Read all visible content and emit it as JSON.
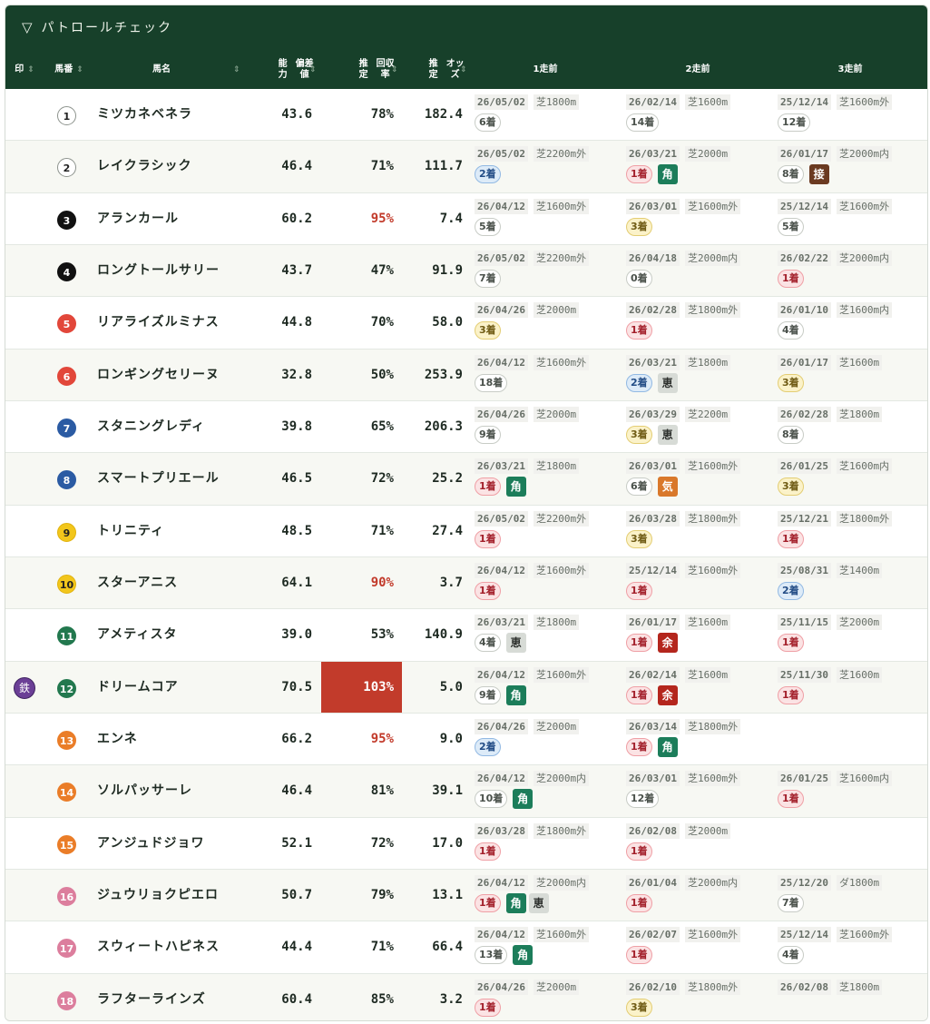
{
  "title": "パトロールチェック",
  "toggle_icon": "▽",
  "headers": {
    "mark": "印",
    "number": "馬番",
    "name": "馬名",
    "ability": [
      "能力",
      "偏差値"
    ],
    "return_rate": [
      "推定",
      "回収率"
    ],
    "odds": [
      "推定",
      "オッズ"
    ],
    "race1": "1走前",
    "race2": "2走前",
    "race3": "3走前"
  },
  "colors": {
    "header_bg": "#17402a",
    "highlight_red": "#c23a2a",
    "place_1": "#fbe3e4",
    "place_2": "#ddebf8",
    "place_3": "#fbf2c9",
    "tag_kaku": "#1c7d5a",
    "tag_yo": "#b4261d",
    "tag_ki": "#d9782b",
    "tag_setsu": "#6b3a21",
    "mark_tetsu": "#6b3f96"
  },
  "rows": [
    {
      "mark": "",
      "num": "1",
      "num_color": "white",
      "name": "ミツカネベネラ",
      "dev": "43.6",
      "ret": "78%",
      "ret_style": "",
      "odds": "182.4",
      "races": [
        {
          "date": "26/05/02",
          "course": "芝1800m",
          "place": "6着",
          "pc": 0,
          "tags": []
        },
        {
          "date": "26/02/14",
          "course": "芝1600m",
          "place": "14着",
          "pc": 0,
          "tags": []
        },
        {
          "date": "25/12/14",
          "course": "芝1600m外",
          "place": "12着",
          "pc": 0,
          "tags": []
        }
      ]
    },
    {
      "mark": "",
      "num": "2",
      "num_color": "white",
      "name": "レイクラシック",
      "dev": "46.4",
      "ret": "71%",
      "ret_style": "",
      "odds": "111.7",
      "races": [
        {
          "date": "26/05/02",
          "course": "芝2200m外",
          "place": "2着",
          "pc": 2,
          "tags": []
        },
        {
          "date": "26/03/21",
          "course": "芝2000m",
          "place": "1着",
          "pc": 1,
          "tags": [
            "角"
          ]
        },
        {
          "date": "26/01/17",
          "course": "芝2000m内",
          "place": "8着",
          "pc": 0,
          "tags": [
            "接"
          ]
        }
      ]
    },
    {
      "mark": "",
      "num": "3",
      "num_color": "black",
      "name": "アランカール",
      "dev": "60.2",
      "ret": "95%",
      "ret_style": "red",
      "odds": "7.4",
      "races": [
        {
          "date": "26/04/12",
          "course": "芝1600m外",
          "place": "5着",
          "pc": 0,
          "tags": []
        },
        {
          "date": "26/03/01",
          "course": "芝1600m外",
          "place": "3着",
          "pc": 3,
          "tags": []
        },
        {
          "date": "25/12/14",
          "course": "芝1600m外",
          "place": "5着",
          "pc": 0,
          "tags": []
        }
      ]
    },
    {
      "mark": "",
      "num": "4",
      "num_color": "black",
      "name": "ロングトールサリー",
      "dev": "43.7",
      "ret": "47%",
      "ret_style": "",
      "odds": "91.9",
      "races": [
        {
          "date": "26/05/02",
          "course": "芝2200m外",
          "place": "7着",
          "pc": 0,
          "tags": []
        },
        {
          "date": "26/04/18",
          "course": "芝2000m内",
          "place": "0着",
          "pc": 0,
          "tags": []
        },
        {
          "date": "26/02/22",
          "course": "芝2000m内",
          "place": "1着",
          "pc": 1,
          "tags": []
        }
      ]
    },
    {
      "mark": "",
      "num": "5",
      "num_color": "red",
      "name": "リアライズルミナス",
      "dev": "44.8",
      "ret": "70%",
      "ret_style": "",
      "odds": "58.0",
      "races": [
        {
          "date": "26/04/26",
          "course": "芝2000m",
          "place": "3着",
          "pc": 3,
          "tags": []
        },
        {
          "date": "26/02/28",
          "course": "芝1800m外",
          "place": "1着",
          "pc": 1,
          "tags": []
        },
        {
          "date": "26/01/10",
          "course": "芝1600m内",
          "place": "4着",
          "pc": 0,
          "tags": []
        }
      ]
    },
    {
      "mark": "",
      "num": "6",
      "num_color": "red",
      "name": "ロンギングセリーヌ",
      "dev": "32.8",
      "ret": "50%",
      "ret_style": "",
      "odds": "253.9",
      "races": [
        {
          "date": "26/04/12",
          "course": "芝1600m外",
          "place": "18着",
          "pc": 0,
          "tags": []
        },
        {
          "date": "26/03/21",
          "course": "芝1800m",
          "place": "2着",
          "pc": 2,
          "tags": [
            "恵"
          ]
        },
        {
          "date": "26/01/17",
          "course": "芝1600m",
          "place": "3着",
          "pc": 3,
          "tags": []
        }
      ]
    },
    {
      "mark": "",
      "num": "7",
      "num_color": "blue",
      "name": "スタニングレディ",
      "dev": "39.8",
      "ret": "65%",
      "ret_style": "",
      "odds": "206.3",
      "races": [
        {
          "date": "26/04/26",
          "course": "芝2000m",
          "place": "9着",
          "pc": 0,
          "tags": []
        },
        {
          "date": "26/03/29",
          "course": "芝2200m",
          "place": "3着",
          "pc": 3,
          "tags": [
            "恵"
          ]
        },
        {
          "date": "26/02/28",
          "course": "芝1800m",
          "place": "8着",
          "pc": 0,
          "tags": []
        }
      ]
    },
    {
      "mark": "",
      "num": "8",
      "num_color": "blue",
      "name": "スマートプリエール",
      "dev": "46.5",
      "ret": "72%",
      "ret_style": "",
      "odds": "25.2",
      "races": [
        {
          "date": "26/03/21",
          "course": "芝1800m",
          "place": "1着",
          "pc": 1,
          "tags": [
            "角"
          ]
        },
        {
          "date": "26/03/01",
          "course": "芝1600m外",
          "place": "6着",
          "pc": 0,
          "tags": [
            "気"
          ]
        },
        {
          "date": "26/01/25",
          "course": "芝1600m内",
          "place": "3着",
          "pc": 3,
          "tags": []
        }
      ]
    },
    {
      "mark": "",
      "num": "9",
      "num_color": "yellow",
      "name": "トリニティ",
      "dev": "48.5",
      "ret": "71%",
      "ret_style": "",
      "odds": "27.4",
      "races": [
        {
          "date": "26/05/02",
          "course": "芝2200m外",
          "place": "1着",
          "pc": 1,
          "tags": []
        },
        {
          "date": "26/03/28",
          "course": "芝1800m外",
          "place": "3着",
          "pc": 3,
          "tags": []
        },
        {
          "date": "25/12/21",
          "course": "芝1800m外",
          "place": "1着",
          "pc": 1,
          "tags": []
        }
      ]
    },
    {
      "mark": "",
      "num": "10",
      "num_color": "yellow",
      "name": "スターアニス",
      "dev": "64.1",
      "ret": "90%",
      "ret_style": "red",
      "odds": "3.7",
      "races": [
        {
          "date": "26/04/12",
          "course": "芝1600m外",
          "place": "1着",
          "pc": 1,
          "tags": []
        },
        {
          "date": "25/12/14",
          "course": "芝1600m外",
          "place": "1着",
          "pc": 1,
          "tags": []
        },
        {
          "date": "25/08/31",
          "course": "芝1400m",
          "place": "2着",
          "pc": 2,
          "tags": []
        }
      ]
    },
    {
      "mark": "",
      "num": "11",
      "num_color": "green",
      "name": "アメティスタ",
      "dev": "39.0",
      "ret": "53%",
      "ret_style": "",
      "odds": "140.9",
      "races": [
        {
          "date": "26/03/21",
          "course": "芝1800m",
          "place": "4着",
          "pc": 0,
          "tags": [
            "恵"
          ]
        },
        {
          "date": "26/01/17",
          "course": "芝1600m",
          "place": "1着",
          "pc": 1,
          "tags": [
            "余"
          ]
        },
        {
          "date": "25/11/15",
          "course": "芝2000m",
          "place": "1着",
          "pc": 1,
          "tags": []
        }
      ]
    },
    {
      "mark": "鉄",
      "num": "12",
      "num_color": "green",
      "name": "ドリームコア",
      "dev": "70.5",
      "ret": "103%",
      "ret_style": "box",
      "odds": "5.0",
      "races": [
        {
          "date": "26/04/12",
          "course": "芝1600m外",
          "place": "9着",
          "pc": 0,
          "tags": [
            "角"
          ]
        },
        {
          "date": "26/02/14",
          "course": "芝1600m",
          "place": "1着",
          "pc": 1,
          "tags": [
            "余"
          ]
        },
        {
          "date": "25/11/30",
          "course": "芝1600m",
          "place": "1着",
          "pc": 1,
          "tags": []
        }
      ]
    },
    {
      "mark": "",
      "num": "13",
      "num_color": "orange",
      "name": "エンネ",
      "dev": "66.2",
      "ret": "95%",
      "ret_style": "red",
      "odds": "9.0",
      "races": [
        {
          "date": "26/04/26",
          "course": "芝2000m",
          "place": "2着",
          "pc": 2,
          "tags": []
        },
        {
          "date": "26/03/14",
          "course": "芝1800m外",
          "place": "1着",
          "pc": 1,
          "tags": [
            "角"
          ]
        },
        null
      ]
    },
    {
      "mark": "",
      "num": "14",
      "num_color": "orange",
      "name": "ソルパッサーレ",
      "dev": "46.4",
      "ret": "81%",
      "ret_style": "",
      "odds": "39.1",
      "races": [
        {
          "date": "26/04/12",
          "course": "芝2000m内",
          "place": "10着",
          "pc": 0,
          "tags": [
            "角"
          ]
        },
        {
          "date": "26/03/01",
          "course": "芝1600m外",
          "place": "12着",
          "pc": 0,
          "tags": []
        },
        {
          "date": "26/01/25",
          "course": "芝1600m内",
          "place": "1着",
          "pc": 1,
          "tags": []
        }
      ]
    },
    {
      "mark": "",
      "num": "15",
      "num_color": "orange",
      "name": "アンジュドジョワ",
      "dev": "52.1",
      "ret": "72%",
      "ret_style": "",
      "odds": "17.0",
      "races": [
        {
          "date": "26/03/28",
          "course": "芝1800m外",
          "place": "1着",
          "pc": 1,
          "tags": []
        },
        {
          "date": "26/02/08",
          "course": "芝2000m",
          "place": "1着",
          "pc": 1,
          "tags": []
        },
        null
      ]
    },
    {
      "mark": "",
      "num": "16",
      "num_color": "pink",
      "name": "ジュウリョクピエロ",
      "dev": "50.7",
      "ret": "79%",
      "ret_style": "",
      "odds": "13.1",
      "races": [
        {
          "date": "26/04/12",
          "course": "芝2000m内",
          "place": "1着",
          "pc": 1,
          "tags": [
            "角",
            "恵"
          ]
        },
        {
          "date": "26/01/04",
          "course": "芝2000m内",
          "place": "1着",
          "pc": 1,
          "tags": []
        },
        {
          "date": "25/12/20",
          "course": "ダ1800m",
          "place": "7着",
          "pc": 0,
          "tags": []
        }
      ]
    },
    {
      "mark": "",
      "num": "17",
      "num_color": "pink",
      "name": "スウィートハピネス",
      "dev": "44.4",
      "ret": "71%",
      "ret_style": "",
      "odds": "66.4",
      "races": [
        {
          "date": "26/04/12",
          "course": "芝1600m外",
          "place": "13着",
          "pc": 0,
          "tags": [
            "角"
          ]
        },
        {
          "date": "26/02/07",
          "course": "芝1600m外",
          "place": "1着",
          "pc": 1,
          "tags": []
        },
        {
          "date": "25/12/14",
          "course": "芝1600m外",
          "place": "4着",
          "pc": 0,
          "tags": []
        }
      ]
    },
    {
      "mark": "",
      "num": "18",
      "num_color": "pink",
      "name": "ラフターラインズ",
      "dev": "60.4",
      "ret": "85%",
      "ret_style": "",
      "odds": "3.2",
      "races": [
        {
          "date": "26/04/26",
          "course": "芝2000m",
          "place": "1着",
          "pc": 1,
          "tags": []
        },
        {
          "date": "26/02/10",
          "course": "芝1800m外",
          "place": "3着",
          "pc": 3,
          "tags": []
        },
        {
          "date": "26/02/08",
          "course": "芝1800m",
          "place": "",
          "pc": -1,
          "tags": []
        }
      ]
    }
  ]
}
